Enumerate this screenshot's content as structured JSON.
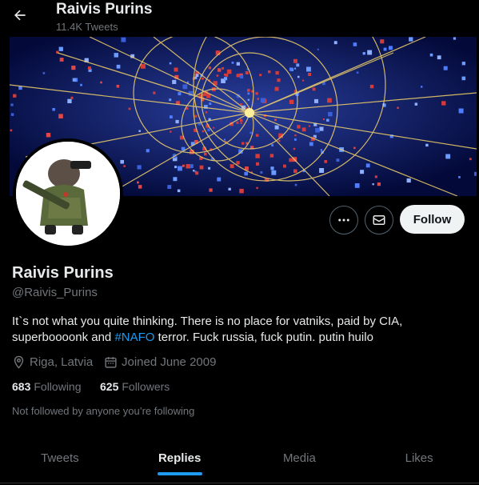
{
  "header": {
    "name": "Raivis Purins",
    "tweet_count": "11.4K Tweets"
  },
  "profile": {
    "name": "Raivis Purins",
    "handle": "@Raivis_Purins",
    "bio_part1": "It`s not what you quite thinking. There is no place for vatniks, paid by CIA, superboooonk and ",
    "bio_hashtag": "#NAFO",
    "bio_part2": " terror. Fuck russia, fuck putin. putin huilo",
    "location": "Riga, Latvia",
    "joined": "Joined June 2009",
    "following_count": "683",
    "following_label": "Following",
    "followers_count": "625",
    "followers_label": "Followers",
    "followed_by_note": "Not followed by anyone you’re following"
  },
  "actions": {
    "follow_label": "Follow",
    "more_icon": "more-icon",
    "message_icon": "envelope-icon"
  },
  "tabs": [
    {
      "label": "Tweets",
      "active": false
    },
    {
      "label": "Replies",
      "active": true
    },
    {
      "label": "Media",
      "active": false
    },
    {
      "label": "Likes",
      "active": false
    }
  ],
  "colors": {
    "accent": "#1d9bf0",
    "background": "#000000",
    "muted": "#71767b"
  }
}
